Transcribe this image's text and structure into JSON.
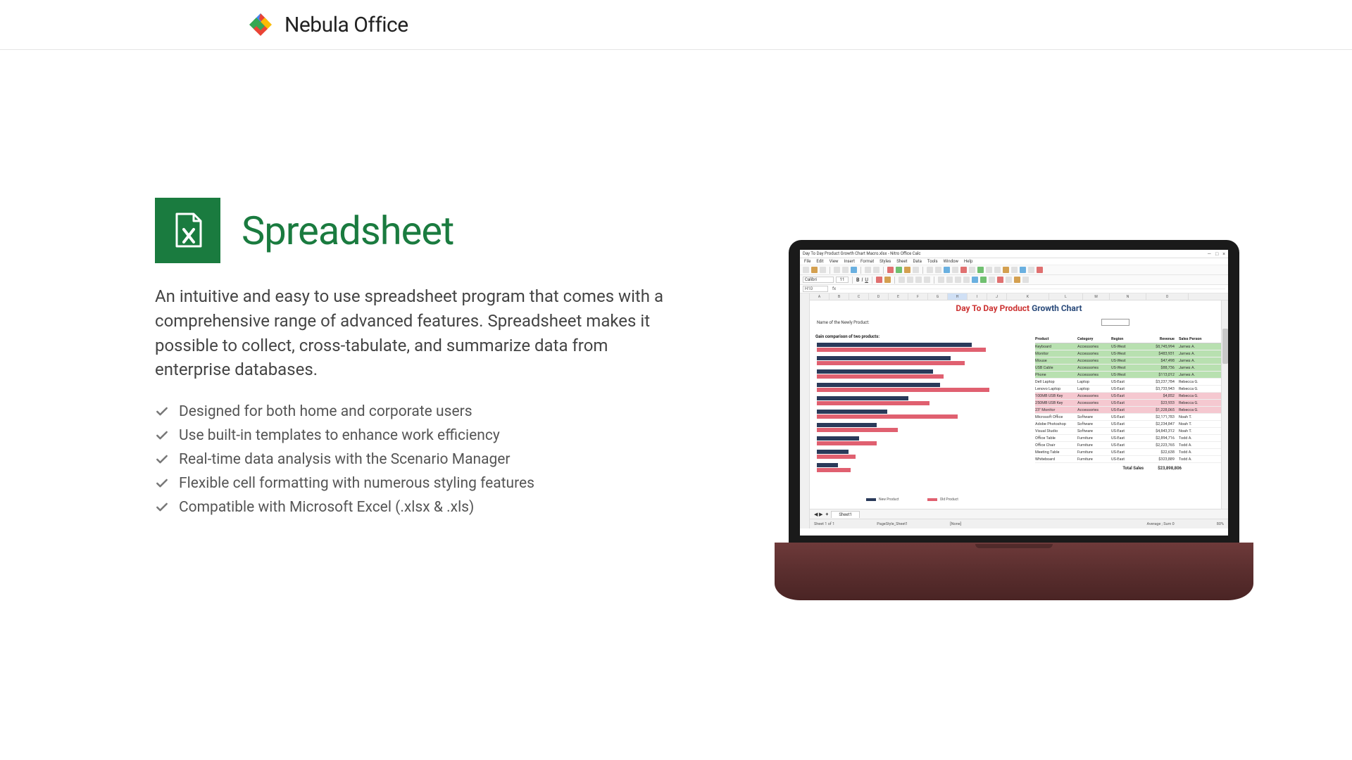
{
  "brand": "Nebula Office",
  "app": {
    "title": "Spreadsheet",
    "description": "An intuitive and easy to use spreadsheet program that comes with a comprehensive range of advanced features. Spreadsheet makes it possible to collect, cross-tabulate, and summarize data from enterprise databases.",
    "features": [
      "Designed for both home and corporate users",
      "Use built-in templates to enhance work efficiency",
      "Real-time data analysis with the Scenario Manager",
      "Flexible cell formatting with numerous styling features",
      "Compatible with Microsoft Excel (.xlsx & .xls)"
    ]
  },
  "screenshot": {
    "window_title": "Day To Day Product Growth Chart Macro.xlsx - Nitro Office Calc",
    "menus": [
      "File",
      "Edit",
      "View",
      "Insert",
      "Format",
      "Styles",
      "Sheet",
      "Data",
      "Tools",
      "Window",
      "Help"
    ],
    "font_box": "Calibri",
    "font_size": "11",
    "formula_cell": "H10",
    "chart_title_red": "Day To Day Product ",
    "chart_title_blue": "Growth Chart",
    "subhead_label": "Name of the Newly Product:",
    "comparison_label": "Gain comparison of two products:",
    "table": {
      "headers": [
        "Product",
        "Category",
        "Region",
        "Revenue",
        "Sales Person"
      ],
      "rows": [
        {
          "product": "Keyboard",
          "category": "Accessories",
          "region": "US-West",
          "revenue": "$8,745,994",
          "person": "James A.",
          "hl": "green"
        },
        {
          "product": "Monitor",
          "category": "Accessories",
          "region": "US-West",
          "revenue": "$483,931",
          "person": "James A.",
          "hl": "green"
        },
        {
          "product": "Mouse",
          "category": "Accessories",
          "region": "US-West",
          "revenue": "$47,498",
          "person": "James A.",
          "hl": "green"
        },
        {
          "product": "USB Cable",
          "category": "Accessories",
          "region": "US-West",
          "revenue": "$88,736",
          "person": "James A.",
          "hl": "green"
        },
        {
          "product": "Phone",
          "category": "Accessories",
          "region": "US-West",
          "revenue": "$113,012",
          "person": "James A.",
          "hl": "green"
        },
        {
          "product": "Dell Laptop",
          "category": "Laptop",
          "region": "US-East",
          "revenue": "$3,237,784",
          "person": "Rebecca G.",
          "hl": ""
        },
        {
          "product": "Lenovo Laptop",
          "category": "Laptop",
          "region": "US-East",
          "revenue": "$3,733,943",
          "person": "Rebecca G.",
          "hl": ""
        },
        {
          "product": "100MB USB Key",
          "category": "Accessories",
          "region": "US-East",
          "revenue": "$4,852",
          "person": "Rebecca G.",
          "hl": "pink"
        },
        {
          "product": "250MB USB Key",
          "category": "Accessories",
          "region": "US-East",
          "revenue": "$23,933",
          "person": "Rebecca G.",
          "hl": "pink"
        },
        {
          "product": "23\" Monitor",
          "category": "Accessories",
          "region": "US-East",
          "revenue": "$1,228,065",
          "person": "Rebecca G.",
          "hl": "pink"
        },
        {
          "product": "Microsoft Office",
          "category": "Software",
          "region": "US-East",
          "revenue": "$2,171,783",
          "person": "Noah T.",
          "hl": ""
        },
        {
          "product": "Adobe Photoshop",
          "category": "Software",
          "region": "US-East",
          "revenue": "$2,234,847",
          "person": "Noah T.",
          "hl": ""
        },
        {
          "product": "Visual Studio",
          "category": "Software",
          "region": "US-East",
          "revenue": "$4,843,312",
          "person": "Noah T.",
          "hl": ""
        },
        {
          "product": "Office Table",
          "category": "Furniture",
          "region": "US-East",
          "revenue": "$2,894,716",
          "person": "Todd A.",
          "hl": ""
        },
        {
          "product": "Office Chair",
          "category": "Furniture",
          "region": "US-East",
          "revenue": "$2,223,765",
          "person": "Todd A.",
          "hl": ""
        },
        {
          "product": "Meeting Table",
          "category": "Furniture",
          "region": "US-East",
          "revenue": "$22,638",
          "person": "Todd A.",
          "hl": ""
        },
        {
          "product": "Whiteboard",
          "category": "Furniture",
          "region": "US-East",
          "revenue": "$323,889",
          "person": "Todd A.",
          "hl": ""
        }
      ],
      "total_label": "Total Sales",
      "total_value": "$23,898,806"
    },
    "bars": [
      {
        "dark": 220,
        "red": 240
      },
      {
        "dark": 190,
        "red": 210
      },
      {
        "dark": 165,
        "red": 180
      },
      {
        "dark": 175,
        "red": 245
      },
      {
        "dark": 130,
        "red": 160
      },
      {
        "dark": 100,
        "red": 200
      },
      {
        "dark": 85,
        "red": 115
      },
      {
        "dark": 60,
        "red": 85
      },
      {
        "dark": 45,
        "red": 55
      },
      {
        "dark": 30,
        "red": 48
      }
    ],
    "legend": {
      "a": "New Product",
      "b": "Old Product"
    },
    "sheet_tab": "Sheet1",
    "sheet_counter": "Sheet 1 of 1",
    "status": {
      "pagestyle": "PageStyle_Sheet1",
      "lang": "[None]",
      "avg": "Average ; Sum 0",
      "zoom": "80%"
    }
  }
}
